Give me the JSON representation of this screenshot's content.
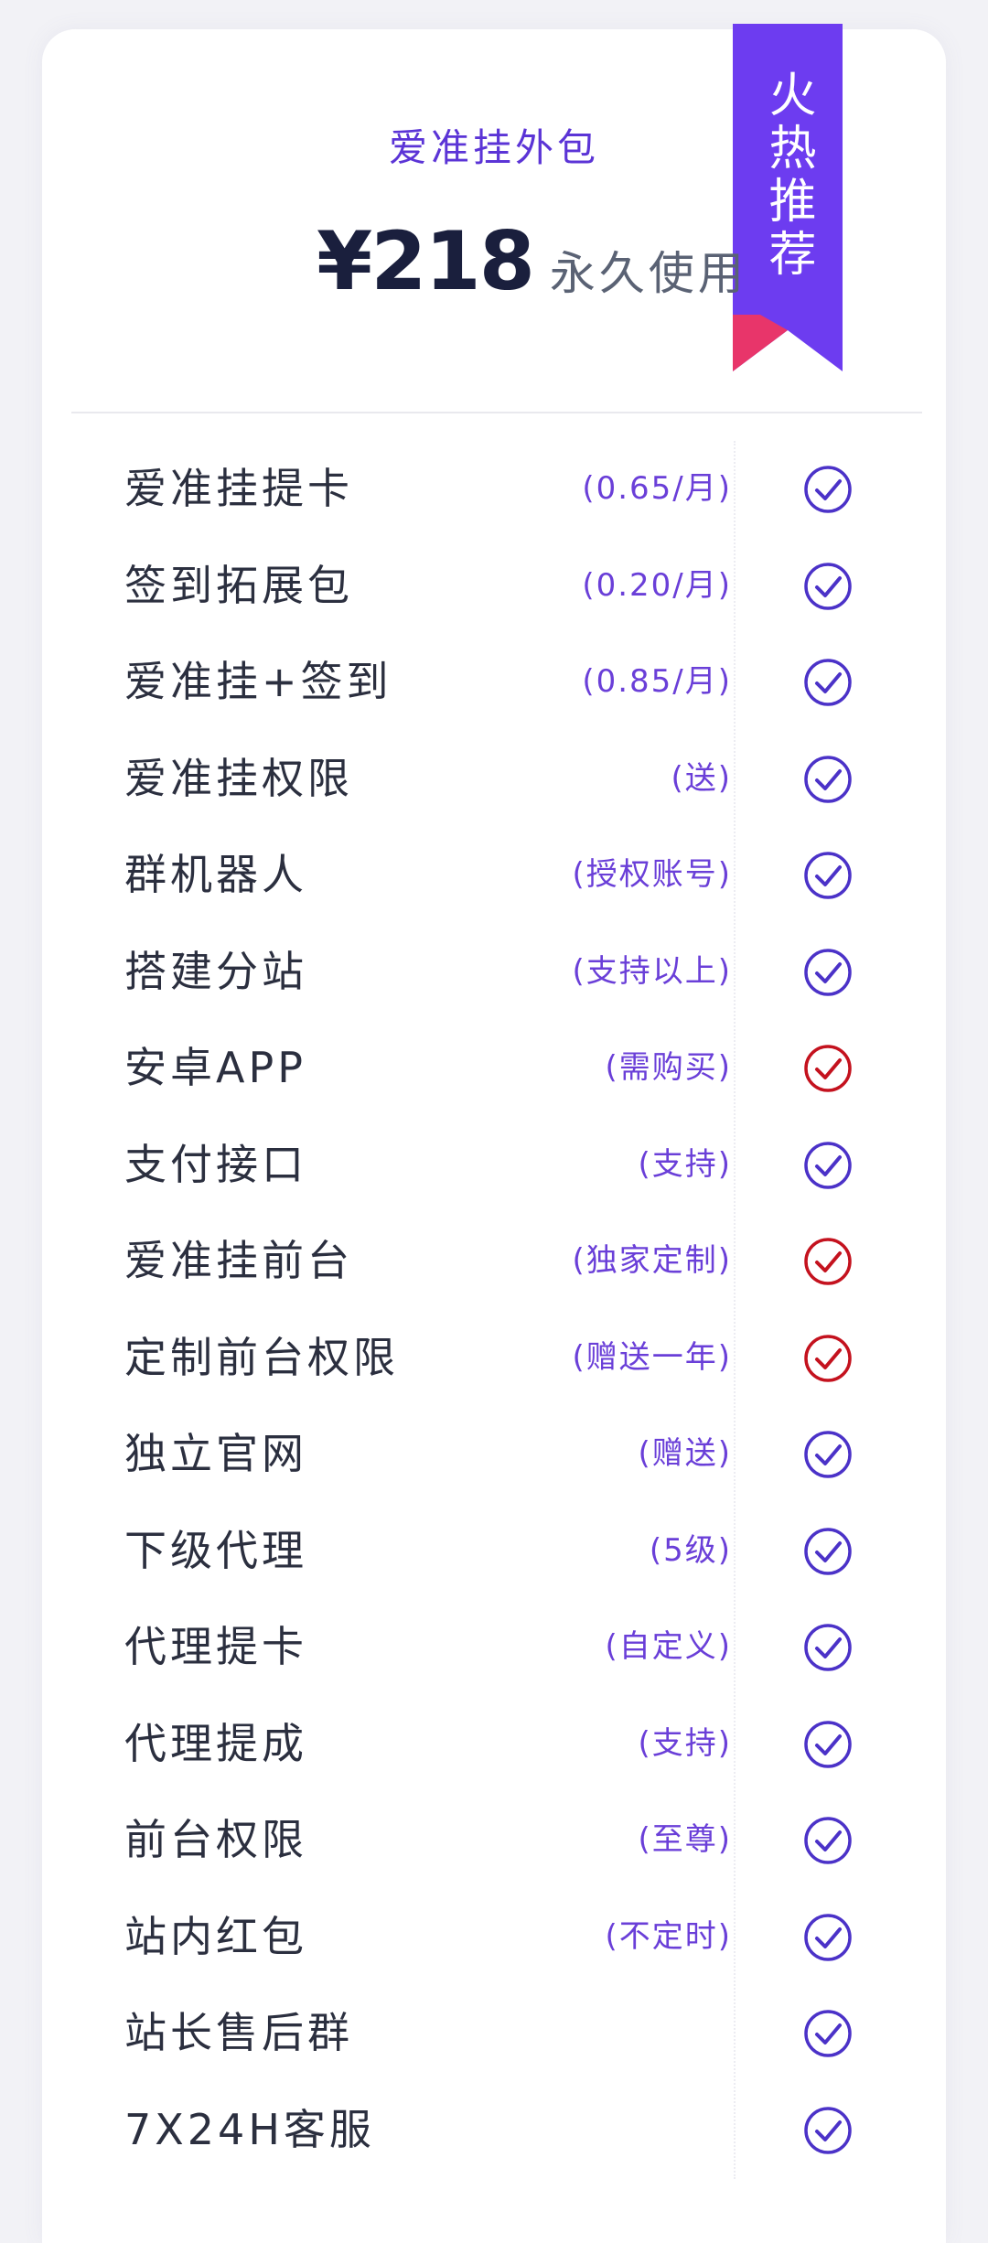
{
  "ribbon": {
    "label": "火热推荐",
    "color": "#6d3cf0",
    "tail_color": "#e8356a"
  },
  "header": {
    "title": "爱准挂外包",
    "price": "¥218",
    "period": "永久使用"
  },
  "colors": {
    "check_default": "#4b32c8",
    "check_highlight": "#c4121e",
    "note": "#6a3fd8"
  },
  "features": [
    {
      "label": "爱准挂提卡",
      "note": "(0.65/月)",
      "check": "check-circle-icon",
      "highlight": false
    },
    {
      "label": "签到拓展包",
      "note": "(0.20/月)",
      "check": "check-circle-icon",
      "highlight": false
    },
    {
      "label": "爱准挂+签到",
      "note": "(0.85/月)",
      "check": "check-circle-icon",
      "highlight": false
    },
    {
      "label": "爱准挂权限",
      "note": "(送)",
      "check": "check-circle-icon",
      "highlight": false
    },
    {
      "label": "群机器人",
      "note": "(授权账号)",
      "check": "check-circle-icon",
      "highlight": false
    },
    {
      "label": "搭建分站",
      "note": "(支持以上)",
      "check": "check-circle-icon",
      "highlight": false
    },
    {
      "label": "安卓APP",
      "note": "(需购买)",
      "check": "check-circle-icon",
      "highlight": true
    },
    {
      "label": "支付接口",
      "note": "(支持)",
      "check": "check-circle-icon",
      "highlight": false
    },
    {
      "label": "爱准挂前台",
      "note": "(独家定制)",
      "check": "check-circle-icon",
      "highlight": true
    },
    {
      "label": "定制前台权限",
      "note": "(赠送一年)",
      "check": "check-circle-icon",
      "highlight": true
    },
    {
      "label": "独立官网",
      "note": "(赠送)",
      "check": "check-circle-icon",
      "highlight": false
    },
    {
      "label": "下级代理",
      "note": "(5级)",
      "check": "check-circle-icon",
      "highlight": false
    },
    {
      "label": "代理提卡",
      "note": "(自定义)",
      "check": "check-circle-icon",
      "highlight": false
    },
    {
      "label": "代理提成",
      "note": "(支持)",
      "check": "check-circle-icon",
      "highlight": false
    },
    {
      "label": "前台权限",
      "note": "(至尊)",
      "check": "check-circle-icon",
      "highlight": false
    },
    {
      "label": "站内红包",
      "note": "(不定时)",
      "check": "check-circle-icon",
      "highlight": false
    },
    {
      "label": "站长售后群",
      "note": "",
      "check": "check-circle-icon",
      "highlight": false
    },
    {
      "label": "7X24H客服",
      "note": "",
      "check": "check-circle-icon",
      "highlight": false
    }
  ]
}
